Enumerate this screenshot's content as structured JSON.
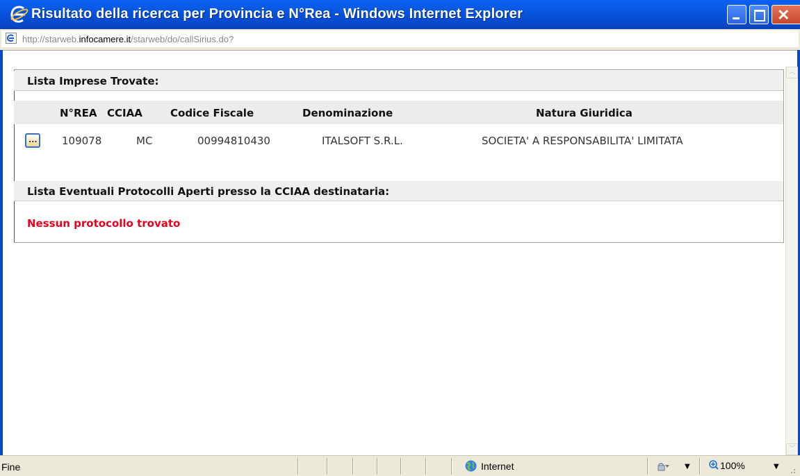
{
  "window": {
    "title": "Risultato della ricerca per Provincia e N°Rea - Windows Internet Explorer"
  },
  "address": {
    "prefix": "http://starweb.",
    "domain": "infocamere.it",
    "suffix": "/starweb/do/callSirius.do?"
  },
  "page": {
    "imprese_header": "Lista Imprese Trovate:",
    "columns": [
      "N°REA",
      "CCIAA",
      "Codice Fiscale",
      "Denominazione",
      "Natura Giuridica"
    ],
    "rows": [
      {
        "detail_label": "...",
        "rea": "109078",
        "cciaa": "MC",
        "codice_fiscale": "00994810430",
        "denominazione": "ITALSOFT S.R.L.",
        "natura_giuridica": "SOCIETA' A RESPONSABILITA' LIMITATA"
      }
    ],
    "protocolli_header": "Lista Eventuali Protocolli Aperti presso la CCIAA destinataria:",
    "no_protocol": "Nessun protocollo trovato"
  },
  "status": {
    "text": "Fine",
    "zone": "Internet",
    "zoom": "100%"
  },
  "icons": {
    "title": "ie-logo-icon",
    "address": "ie-page-icon",
    "zone": "globe-icon",
    "security": "lock-icon",
    "zoom": "magnifier-icon"
  },
  "colors": {
    "title_bar": "#0550d8",
    "no_protocol": "#e8001c",
    "section_bg": "#efefef"
  }
}
